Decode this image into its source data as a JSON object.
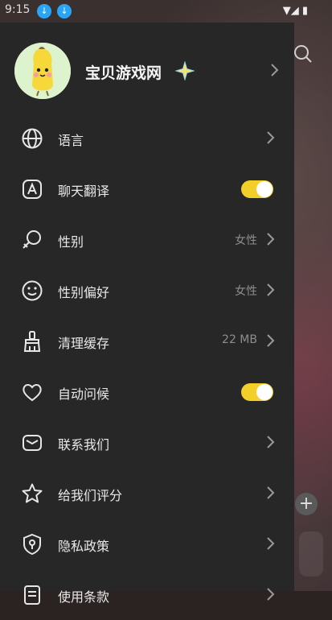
{
  "status_bar": {
    "time": "9:15"
  },
  "profile": {
    "name": "宝贝游戏网"
  },
  "menu": [
    {
      "label": "语言",
      "value": "",
      "control": "chevron",
      "icon": "globe-icon"
    },
    {
      "label": "聊天翻译",
      "value": "",
      "control": "toggle",
      "on": true,
      "icon": "translate-icon"
    },
    {
      "label": "性别",
      "value": "女性",
      "control": "chevron",
      "icon": "gender-icon"
    },
    {
      "label": "性别偏好",
      "value": "女性",
      "control": "chevron",
      "icon": "smiley-icon"
    },
    {
      "label": "清理缓存",
      "value": "22 MB",
      "control": "chevron",
      "icon": "broom-icon"
    },
    {
      "label": "自动问候",
      "value": "",
      "control": "toggle",
      "on": true,
      "icon": "heart-icon"
    },
    {
      "label": "联系我们",
      "value": "",
      "control": "chevron",
      "icon": "mail-icon"
    },
    {
      "label": "给我们评分",
      "value": "",
      "control": "chevron",
      "icon": "star-icon"
    },
    {
      "label": "隐私政策",
      "value": "",
      "control": "chevron",
      "icon": "shield-icon"
    },
    {
      "label": "使用条款",
      "value": "",
      "control": "chevron",
      "icon": "document-icon"
    }
  ],
  "colors": {
    "accent": "#f4cf2a",
    "drawer_bg": "#272727"
  }
}
